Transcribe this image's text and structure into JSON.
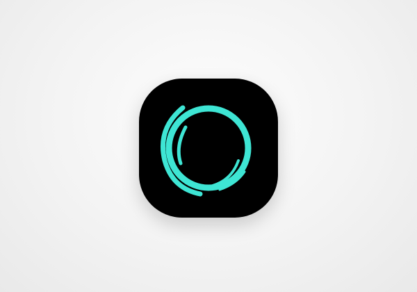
{
  "colors": {
    "background": "#f2f2f2",
    "icon_tile": "#000000",
    "accent": "#3ee5d4"
  },
  "icon": {
    "name": "swirl-ring-icon"
  }
}
